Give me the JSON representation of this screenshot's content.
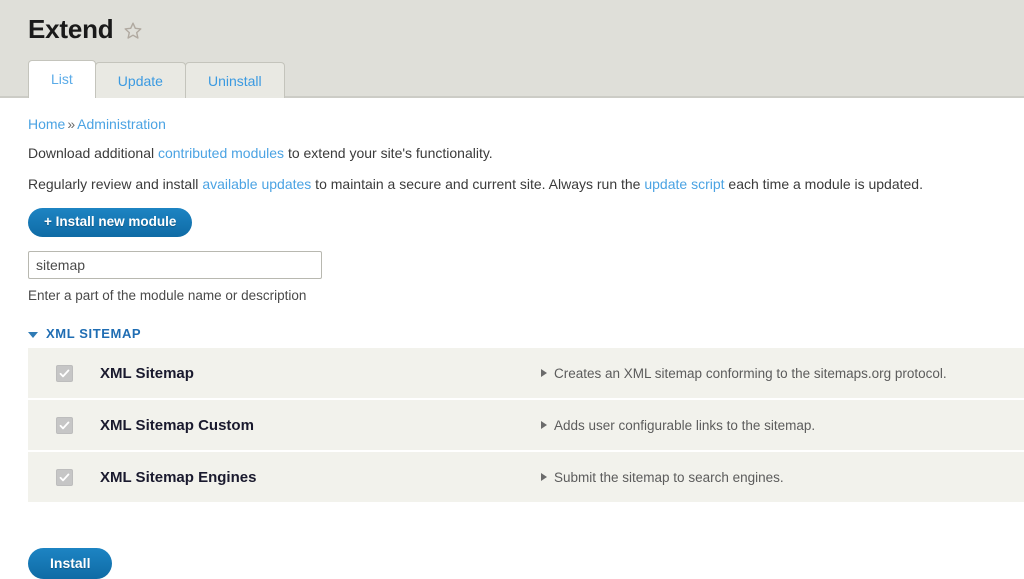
{
  "header": {
    "title": "Extend",
    "star_icon": "star-outline-icon"
  },
  "tabs": [
    {
      "label": "List",
      "active": true
    },
    {
      "label": "Update",
      "active": false
    },
    {
      "label": "Uninstall",
      "active": false
    }
  ],
  "breadcrumb": {
    "items": [
      "Home",
      "Administration"
    ],
    "separator": "»"
  },
  "intro": {
    "line1": {
      "before": "Download additional ",
      "link": "contributed modules",
      "after": " to extend your site's functionality."
    },
    "line2": {
      "before": "Regularly review and install ",
      "link1": "available updates",
      "middle": " to maintain a secure and current site. Always run the ",
      "link2": "update script",
      "after": " each time a module is updated."
    }
  },
  "install_new_module_button": "+ Install new module",
  "filter": {
    "value": "sitemap",
    "placeholder": "",
    "description": "Enter a part of the module name or description"
  },
  "package": {
    "title": "XML SITEMAP",
    "expanded": true,
    "toggle_icon": "triangle-down-icon"
  },
  "modules": [
    {
      "checked": true,
      "disabled": true,
      "name": "XML Sitemap",
      "description": "Creates an XML sitemap conforming to the sitemaps.org protocol."
    },
    {
      "checked": true,
      "disabled": true,
      "name": "XML Sitemap Custom",
      "description": "Adds user configurable links to the sitemap."
    },
    {
      "checked": true,
      "disabled": true,
      "name": "XML Sitemap Engines",
      "description": "Submit the sitemap to search engines."
    }
  ],
  "install_button": "Install",
  "colors": {
    "header_bg": "#dfdfd9",
    "row_bg": "#f2f2ec",
    "link": "#4ba3e3",
    "button": "#1d84c3",
    "package_title": "#1f6db3"
  }
}
